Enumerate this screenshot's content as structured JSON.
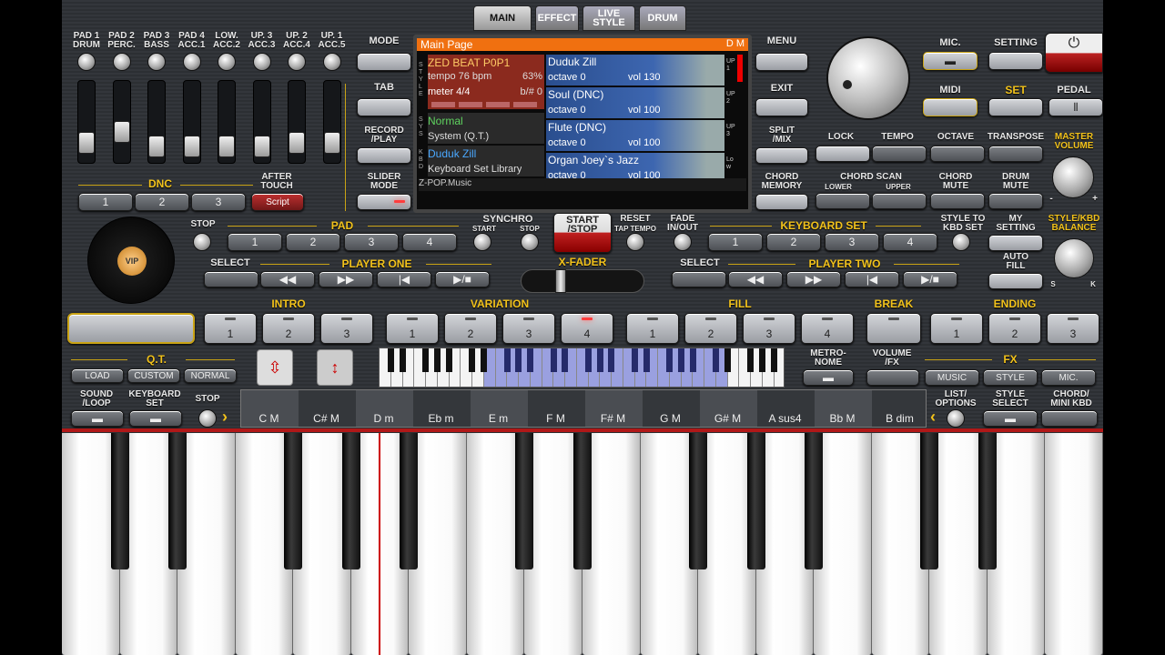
{
  "tabs": [
    "MAIN",
    "EFFECT",
    "LIVE\nSTYLE",
    "DRUM"
  ],
  "pads": [
    "PAD 1\nDRUM",
    "PAD 2\nPERC.",
    "PAD 3\nBASS",
    "PAD 4\nACC.1",
    "LOW.\nACC.2",
    "UP. 3\nACC.3",
    "UP. 2\nACC.4",
    "UP. 1\nACC.5"
  ],
  "left": {
    "mode": "MODE",
    "tab": "TAB",
    "record": "RECORD\n/PLAY",
    "slider": "SLIDER\nMODE",
    "dnc": "DNC",
    "dnc_btns": [
      "1",
      "2",
      "3"
    ],
    "after": "AFTER\nTOUCH",
    "script": "Script"
  },
  "right": {
    "menu": "MENU",
    "exit": "EXIT",
    "split": "SPLIT\n/MIX",
    "chordmem": "CHORD\nMEMORY",
    "mic": "MIC.",
    "setting": "SETTING",
    "midi": "MIDI",
    "set": "SET",
    "pedal": "PEDAL",
    "lock": "LOCK",
    "tempo": "TEMPO",
    "octave": "OCTAVE",
    "transpose": "TRANSPOSE",
    "master": "MASTER\nVOLUME",
    "chordscan": "CHORD SCAN",
    "lower": "LOWER",
    "upper": "UPPER",
    "chordmute": "CHORD\nMUTE",
    "drummute": "DRUM\nMUTE",
    "stylekbd": "STYLE/KBD\nBALANCE",
    "s": "S",
    "k": "K",
    "minus": "-",
    "plus": "+"
  },
  "screen": {
    "title": "Main Page",
    "dm": "D M",
    "style_name": "ZED BEAT P0P1",
    "tempo": "tempo 76 bpm",
    "pct": "63%",
    "meter": "meter 4/4",
    "bsh": "b/#  0",
    "sys_name": "Normal",
    "sys_sub": "System (Q.T.)",
    "kbd_name": "Duduk Zill",
    "kbd_sub": "Keyboard Set Library",
    "footer": "Z-POP.Music",
    "side_l": [
      "STYLE",
      "SYS",
      "KBD"
    ],
    "voices": [
      {
        "name": "Duduk Zill",
        "oct": "octave  0",
        "vol": "vol 130",
        "tag": "UP1"
      },
      {
        "name": "Soul (DNC)",
        "oct": "octave  0",
        "vol": "vol 100",
        "tag": "UP2"
      },
      {
        "name": "Flute (DNC)",
        "oct": "octave  0",
        "vol": "vol 100",
        "tag": "UP3"
      },
      {
        "name": "Organ Joey`s Jazz",
        "oct": "octave  0",
        "vol": "vol 100",
        "tag": "Low"
      }
    ]
  },
  "pad": {
    "label": "PAD",
    "stop": "STOP",
    "btns": [
      "1",
      "2",
      "3",
      "4"
    ]
  },
  "synchro": {
    "label": "SYNCHRO",
    "start": "START",
    "stop": "STOP"
  },
  "startstop": "START\n/STOP",
  "reset": "RESET",
  "taptempo": "TAP TEMPO",
  "fade": "FADE\nIN/OUT",
  "xfader": "X-FADER",
  "kbset": {
    "label": "KEYBOARD SET",
    "btns": [
      "1",
      "2",
      "3",
      "4"
    ],
    "styleto": "STYLE TO\nKBD SET",
    "mysetting": "MY\nSETTING",
    "autofill": "AUTO\nFILL"
  },
  "player1": {
    "label": "PLAYER ONE",
    "select": "SELECT",
    "btns": [
      "◀◀",
      "▶▶",
      "|◀",
      "▶/■"
    ]
  },
  "player2": {
    "label": "PLAYER TWO",
    "select": "SELECT",
    "btns": [
      "◀◀",
      "▶▶",
      "|◀",
      "▶/■"
    ]
  },
  "sections": [
    {
      "label": "INTRO",
      "btns": [
        "1",
        "2",
        "3"
      ]
    },
    {
      "label": "VARIATION",
      "btns": [
        "1",
        "2",
        "3",
        "4"
      ]
    },
    {
      "label": "FILL",
      "btns": [
        "1",
        "2",
        "3",
        "4"
      ]
    },
    {
      "label": "BREAK",
      "btns": [
        ""
      ]
    },
    {
      "label": "ENDING",
      "btns": [
        "1",
        "2",
        "3"
      ]
    }
  ],
  "qt": {
    "label": "Q.T.",
    "btns": [
      "LOAD",
      "CUSTOM",
      "NORMAL"
    ]
  },
  "metronome": "METRO-\nNOME",
  "volumefx": "VOLUME\n/FX",
  "fx": {
    "label": "FX",
    "btns": [
      "MUSIC",
      "STYLE",
      "MIC."
    ]
  },
  "bottom": {
    "sound": "SOUND\n/LOOP",
    "kbdset": "KEYBOARD\nSET",
    "stop": "STOP",
    "list": "LIST/\nOPTIONS",
    "stylesel": "STYLE\nSELECT",
    "chordmini": "CHORD/\nMINI KBD",
    "vip": "VIP"
  },
  "chords": [
    "C M",
    "C# M",
    "D m",
    "Eb m",
    "E m",
    "F M",
    "F# M",
    "G M",
    "G# M",
    "A sus4",
    "Bb M",
    "B dim"
  ]
}
